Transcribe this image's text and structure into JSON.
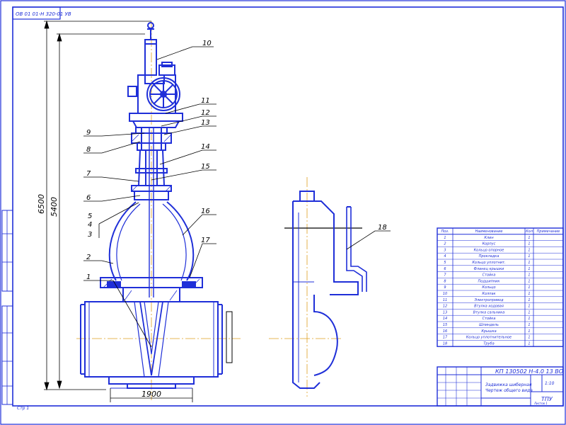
{
  "colors": {
    "line": "#1f2fd8",
    "hatch": "#1f2fd8",
    "axis": "#e0a020",
    "leader": "#000000",
    "dim": "#000000",
    "frame": "#1f2fd8",
    "bg": "#ffffff"
  },
  "stamp_top": "ОВ 01 01-Н 320-01 УВ",
  "dimensions": {
    "overall_height": "6500",
    "upper_height": "5400",
    "base_width": "1900"
  },
  "callouts": [
    "1",
    "2",
    "3",
    "4",
    "5",
    "6",
    "7",
    "8",
    "9",
    "10",
    "11",
    "12",
    "13",
    "14",
    "15",
    "16",
    "17",
    "18"
  ],
  "parts_table": {
    "headers": [
      "Поз.",
      "Наименование",
      "Кол",
      "Примечание"
    ],
    "rows": [
      [
        "1",
        "Клин",
        "1",
        ""
      ],
      [
        "2",
        "Корпус",
        "1",
        ""
      ],
      [
        "3",
        "Кольцо опорное",
        "1",
        ""
      ],
      [
        "4",
        "Прокладка",
        "1",
        ""
      ],
      [
        "5",
        "Кольцо уплотнит.",
        "1",
        ""
      ],
      [
        "6",
        "Фланец крышки",
        "1",
        ""
      ],
      [
        "7",
        "Стойка",
        "1",
        ""
      ],
      [
        "8",
        "Подшипник",
        "1",
        ""
      ],
      [
        "9",
        "Кольцо",
        "1",
        ""
      ],
      [
        "10",
        "Колпак",
        "1",
        ""
      ],
      [
        "11",
        "Электропривод",
        "1",
        ""
      ],
      [
        "12",
        "Втулка ходовая",
        "1",
        ""
      ],
      [
        "13",
        "Втулка сальника",
        "1",
        ""
      ],
      [
        "14",
        "Стойка",
        "1",
        ""
      ],
      [
        "15",
        "Шпиндель",
        "1",
        ""
      ],
      [
        "16",
        "Крышка",
        "1",
        ""
      ],
      [
        "17",
        "Кольцо уплотнительное",
        "1",
        ""
      ],
      [
        "18",
        "Труба",
        "1",
        ""
      ]
    ]
  },
  "title_block": {
    "code": "КП 130502 Н-4.0 13 ВО",
    "name_line1": "Задвижка шиберная",
    "name_line2": "Чертеж общего вида",
    "org": "ТПУ",
    "scale": "1:10",
    "sheet": "Листов 1"
  },
  "corner_mark": "Стр 1"
}
